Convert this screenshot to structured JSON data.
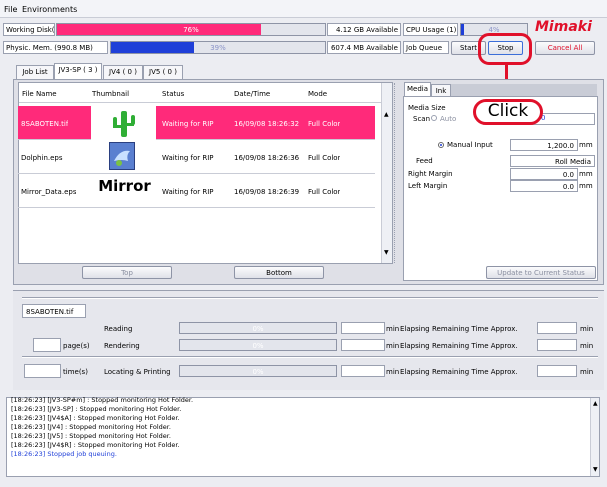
{
  "menu": {
    "file": "File",
    "environments": "Environments"
  },
  "status_bar": {
    "working_disk_label": "Working Disk(C:)",
    "working_disk_percent": 76,
    "working_disk_text": "76%",
    "working_disk_available": "4.12 GB Available",
    "phys_mem_label": "Physic. Mem. (990.8 MB)",
    "phys_mem_percent": 39,
    "phys_mem_text": "39%",
    "phys_mem_available": "607.4 MB Available",
    "cpu_label": "CPU Usage (1)",
    "cpu_percent": 4,
    "cpu_text": "4%",
    "job_queue_label": "Job Queue",
    "start_label": "Start",
    "stop_label": "Stop",
    "cancel_all_label": "Cancel All",
    "logo": "Mimaki"
  },
  "tabs": [
    "Job List",
    "JV3-SP ( 3 )",
    "JV4 ( 0 )",
    "JV5 ( 0 )"
  ],
  "job_table": {
    "headers": [
      "File Name",
      "Thumbnail",
      "Status",
      "Date/Time",
      "Mode"
    ],
    "rows": [
      {
        "file": "8SABOTEN.tif",
        "thumb": "cactus",
        "status": "Waiting for RIP",
        "datetime": "16/09/08 18:26:32",
        "mode": "Full Color"
      },
      {
        "file": "Dolphin.eps",
        "thumb": "dolphin",
        "status": "Waiting for RIP",
        "datetime": "16/09/08 18:26:36",
        "mode": "Full Color"
      },
      {
        "file": "Mirror_Data.eps",
        "thumb": "Mirror",
        "status": "Waiting for RIP",
        "datetime": "16/09/08 18:26:39",
        "mode": "Full Color"
      }
    ],
    "top_label": "Top",
    "bottom_label": "Bottom"
  },
  "right_panel": {
    "tabs": [
      "Media",
      "Ink"
    ],
    "media_size": "Media Size",
    "scan": "Scan",
    "auto": "Auto",
    "manual_input": "Manual Input",
    "manual_value": "1,200.0",
    "unit_mm": "mm",
    "feed": "Feed",
    "feed_value": "Roll Media",
    "right_margin": "Right Margin",
    "right_margin_value": "0.0",
    "left_margin": "Left Margin",
    "left_margin_value": "0.0",
    "scan_value": "0",
    "update_label": "Update to Current Status",
    "click_callout": "Click"
  },
  "progress": {
    "file": "8SABOTEN.tif",
    "pages_unit": "page(s)",
    "time_unit": "time(s)",
    "reading": "Reading",
    "rendering": "Rendering",
    "locating": "Locating & Printing",
    "pct_reading": "0%",
    "pct_rendering": "0%",
    "pct_locating": "0%",
    "min": "min",
    "elapsing": "Elapsing",
    "remaining": "Remaining Time Approx.",
    "min2": "min"
  },
  "log_lines": [
    "[18:26:23] [JV3-SP#m] : Stopped monitoring Hot Folder.",
    "[18:26:23] [JV3-SP] : Stopped monitoring Hot Folder.",
    "[18:26:23] [JV4$A] : Stopped monitoring Hot Folder.",
    "[18:26:23] [JV4] : Stopped monitoring Hot Folder.",
    "[18:26:23] [JV5] : Stopped monitoring Hot Folder.",
    "[18:26:23] [JV4$R] : Stopped monitoring Hot Folder.",
    "[18:26:23] Stopped job queuing."
  ],
  "colors": {
    "accent_pink": "#ff2a7a",
    "accent_blue": "#1f3fd8",
    "callout_red": "#e0102a",
    "logo_red": "#e0102a"
  }
}
